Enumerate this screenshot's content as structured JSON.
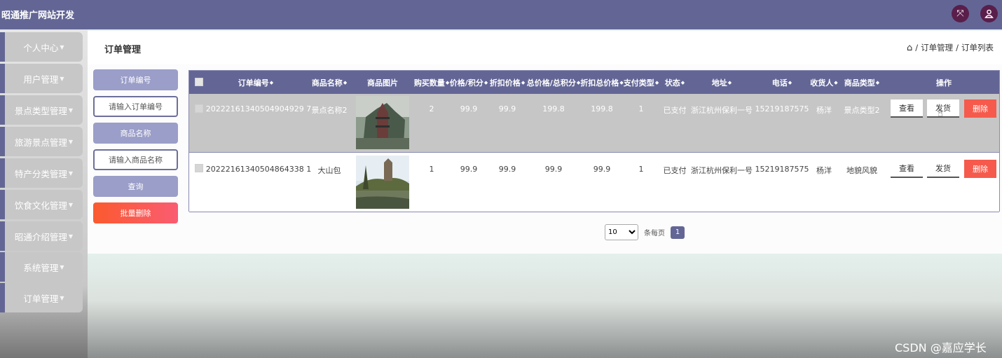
{
  "app": {
    "title": "昭通推广网站开发"
  },
  "topbar": {
    "expand_icon": "expand-icon",
    "user_icon": "user-icon"
  },
  "sidebar": {
    "items": [
      {
        "label": "个人中心"
      },
      {
        "label": "用户管理"
      },
      {
        "label": "景点类型管理"
      },
      {
        "label": "旅游景点管理"
      },
      {
        "label": "特产分类管理"
      },
      {
        "label": "饮食文化管理"
      },
      {
        "label": "昭通介绍管理"
      },
      {
        "label": "系统管理"
      },
      {
        "label": "订单管理"
      }
    ]
  },
  "header": {
    "title": "订单管理",
    "breadcrumb": [
      "订单管理",
      "订单列表"
    ],
    "separator": "/"
  },
  "search": {
    "order_no_label": "订单编号",
    "order_no_placeholder": "请输入订单编号",
    "order_no_value": "",
    "product_name_label": "商品名称",
    "product_name_placeholder": "请输入商品名称",
    "product_name_value": "",
    "query_button": "查询",
    "batch_delete_button": "批量删除"
  },
  "table": {
    "columns": [
      "订单编号",
      "商品名称",
      "商品图片",
      "购买数量",
      "价格/积分",
      "折扣价格",
      "总价格/总积分",
      "折扣总价格",
      "支付类型",
      "状态",
      "地址",
      "电话",
      "收货人",
      "商品类型",
      "操作"
    ],
    "rows": [
      {
        "order_no": "20222161340504904929 7",
        "name": "景点名称2",
        "qty": "2",
        "price": "99.9",
        "discount": "99.9",
        "total": "199.8",
        "discount_total": "199.8",
        "pay_type": "1",
        "status": "已支付",
        "address": "浙江杭州保利一号",
        "phone": "15219187575",
        "receiver": "杨洋",
        "type": "景点类型2",
        "actions": [
          "查看",
          "发货",
          "删除"
        ]
      },
      {
        "order_no": "20222161340504864338 1",
        "name": "大山包",
        "qty": "1",
        "price": "99.9",
        "discount": "99.9",
        "total": "99.9",
        "discount_total": "99.9",
        "pay_type": "1",
        "status": "已支付",
        "address": "浙江杭州保利一号",
        "phone": "15219187575",
        "receiver": "杨洋",
        "type": "地貌风貌",
        "actions": [
          "查看",
          "发货",
          "删除"
        ]
      }
    ]
  },
  "pagination": {
    "page_size": "10",
    "per_page_label": "条每页",
    "current_page": "1"
  },
  "watermark": "CSDN @嘉应学长"
}
